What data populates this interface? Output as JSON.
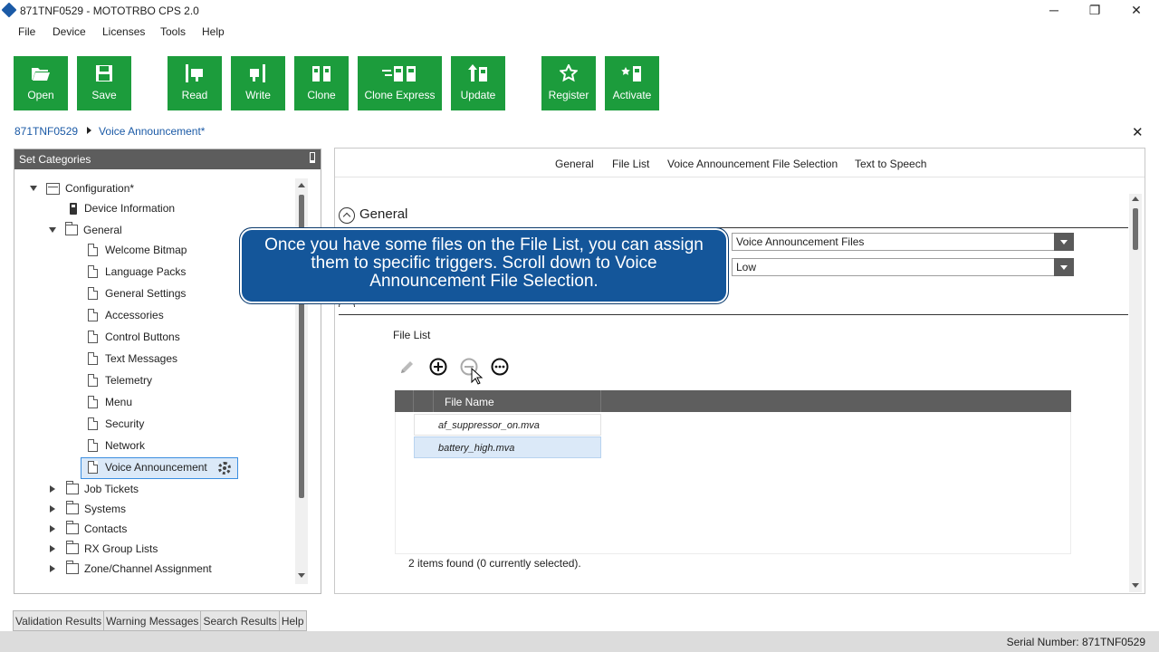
{
  "window": {
    "title": "871TNF0529 - MOTOTRBO CPS 2.0",
    "minimize": "─",
    "restore": "❐",
    "close": "✕"
  },
  "menu": [
    "File",
    "Device",
    "Licenses",
    "Tools",
    "Help"
  ],
  "toolbar": [
    {
      "label": "Open",
      "icon": "open-folder-icon"
    },
    {
      "label": "Save",
      "icon": "save-disk-icon"
    },
    {
      "label": "Read",
      "icon": "read-radio-icon"
    },
    {
      "label": "Write",
      "icon": "write-radio-icon"
    },
    {
      "label": "Clone",
      "icon": "clone-icon"
    },
    {
      "label": "Clone Express",
      "icon": "clone-express-icon"
    },
    {
      "label": "Update",
      "icon": "update-icon"
    },
    {
      "label": "Register",
      "icon": "star-icon"
    },
    {
      "label": "Activate",
      "icon": "activate-icon"
    }
  ],
  "breadcrumb": {
    "root": "871TNF0529",
    "current": "Voice Announcement*"
  },
  "close_tab": "✕",
  "left_panel": {
    "title": "Set Categories",
    "tree": [
      "Configuration*",
      "Device Information",
      "General",
      "Welcome Bitmap",
      "Language Packs",
      "General Settings",
      "Accessories",
      "Control Buttons",
      "Text Messages",
      "Telemetry",
      "Menu",
      "Security",
      "Network",
      "Voice Announcement",
      "Job Tickets",
      "Systems",
      "Contacts",
      "RX Group Lists",
      "Zone/Channel Assignment"
    ]
  },
  "right_panel": {
    "tabs": [
      "General",
      "File List",
      "Voice Announcement File Selection",
      "Text to Speech"
    ],
    "section_title": "General",
    "select1": "Voice Announcement Files",
    "select2": "Low",
    "file_list_label": "File List",
    "grid": {
      "header": "File Name",
      "rows": [
        "af_suppressor_on.mva",
        "battery_high.mva"
      ]
    },
    "count_text": "2 items found (0 currently selected)."
  },
  "callout": "Once you have some files on the File List, you can assign them to specific triggers. Scroll down to Voice Announcement File Selection.",
  "bottom_tabs": [
    "Validation Results",
    "Warning Messages",
    "Search Results",
    "Help"
  ],
  "status": "Serial Number: 871TNF0529",
  "colors": {
    "toolbar_green": "#1c9c3c",
    "callout_blue": "#14569a",
    "link_blue": "#1b5aa6"
  }
}
